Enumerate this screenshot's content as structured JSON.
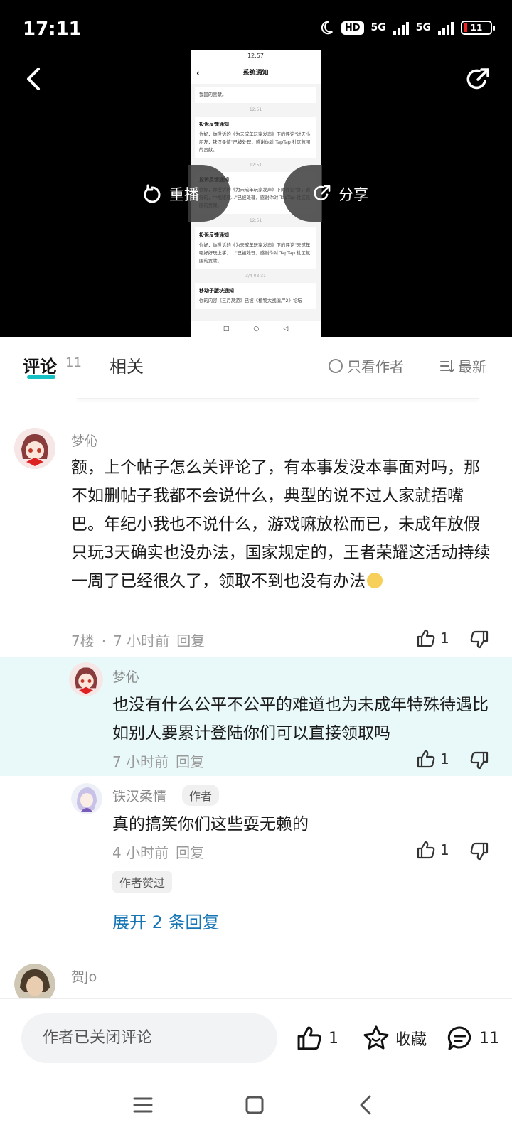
{
  "status_bar": {
    "time": "17:11",
    "hd": "HD",
    "net1": "5G",
    "net2": "5G",
    "battery": "11"
  },
  "video": {
    "replay_label": "重播",
    "share_label": "分享",
    "phone": {
      "time": "12:57",
      "title": "系统通知",
      "cards": [
        {
          "text": "我国的贡献。"
        },
        {
          "time": "12:51"
        },
        {
          "title": "投诉反馈通知",
          "text": "你好，你投诉的《为未成年玩家发声》下的评论\"进天小朋友，铁汉柔情\"已被处理，感谢你对 TapTap 社区氛围的贡献。"
        },
        {
          "time": "12:51"
        },
        {
          "title": "投诉反馈通知",
          "text": "你好，你投诉的《为未成年玩家发声》下的评论\"卧，说好的，中规矩就...\"已被处理，感谢你对 TapTap 社区氛围的贡献。"
        },
        {
          "time": "12:51"
        },
        {
          "title": "投诉反馈通知",
          "text": "你好，你投诉的《为未成年玩家发声》下的评论\"未成年哪好好玩上学，...\"已被处理，感谢你对 TapTap 社区氛围的贡献。"
        },
        {
          "time": "3/4 08:31"
        },
        {
          "title": "移动子版块通知",
          "text": "你的内容《三月莴游》已被《植物大战僵尸2》论坛"
        }
      ]
    }
  },
  "tabs": {
    "comments_label": "评论",
    "comments_count": "11",
    "related_label": "相关",
    "only_author": "只看作者",
    "sort": "最新"
  },
  "comments": [
    {
      "user": "梦伈",
      "text": "额，上个帖子怎么关评论了，有本事发没本事面对吗，那不如删帖子我都不会说什么，典型的说不过人家就捂嘴巴。年纪小我也不说什么，游戏嘛放松而已，未成年放假只玩3天确实也没办法，国家规定的，王者荣耀这活动持续一周了已经很久了，领取不到也没有办法",
      "floor": "7楼",
      "dot": "·",
      "time": "7 小时前",
      "reply": "回复",
      "likes": "1"
    },
    {
      "user": "梦伈",
      "text": "也没有什么公平不公平的难道也为未成年特殊待遇比如别人要累计登陆你们可以直接领取吗",
      "time": "7 小时前",
      "reply": "回复",
      "likes": "1"
    },
    {
      "user": "铁汉柔情",
      "tag": "作者",
      "text": "真的搞笑你们这些耍无赖的",
      "time": "4 小时前",
      "reply": "回复",
      "likes": "1",
      "badge": "作者赞过"
    },
    {
      "user": "贺Jo"
    }
  ],
  "expand_replies": "展开 2 条回复",
  "bottom": {
    "input_placeholder": "作者已关闭评论",
    "likes": "1",
    "collect": "收藏",
    "comments": "11"
  }
}
